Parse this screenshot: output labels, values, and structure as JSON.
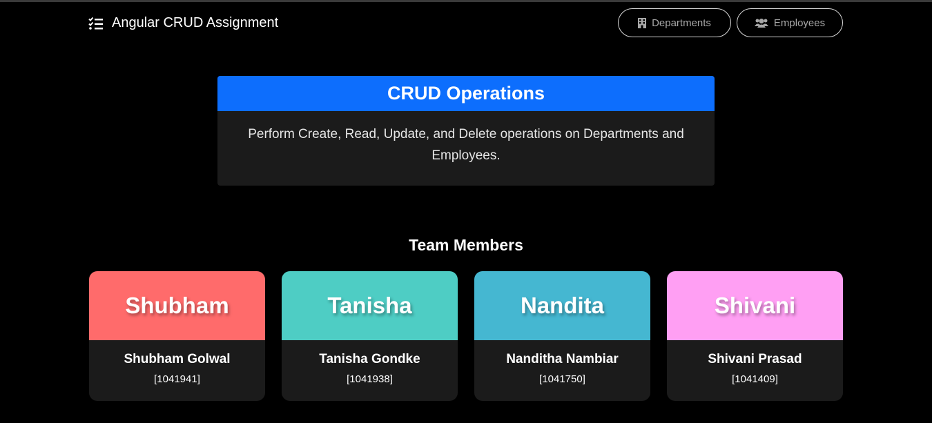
{
  "navbar": {
    "brand_icon": "tasks-list-icon",
    "brand": "Angular CRUD Assignment",
    "buttons": [
      {
        "label": "Departments",
        "icon": "building-icon"
      },
      {
        "label": "Employees",
        "icon": "users-icon"
      }
    ]
  },
  "crud": {
    "title": "CRUD Operations",
    "description_line1": "Perform Create, Read, Update, and Delete operations on Departments and",
    "description_line2": "Employees."
  },
  "team": {
    "title": "Team Members",
    "members": [
      {
        "first_name": "Shubham",
        "full_name": "Shubham Golwal",
        "id": "[1041941]",
        "color": "#ff6b6b"
      },
      {
        "first_name": "Tanisha",
        "full_name": "Tanisha Gondke",
        "id": "[1041938]",
        "color": "#4ecdc4"
      },
      {
        "first_name": "Nandita",
        "full_name": "Nanditha Nambiar",
        "id": "[1041750]",
        "color": "#45b7d1"
      },
      {
        "first_name": "Shivani",
        "full_name": "Shivani Prasad",
        "id": "[1041409]",
        "color": "#ff9ff3"
      }
    ]
  },
  "colors": {
    "background": "#000000",
    "card": "#1b1b1b",
    "primary": "#0d6efd"
  }
}
